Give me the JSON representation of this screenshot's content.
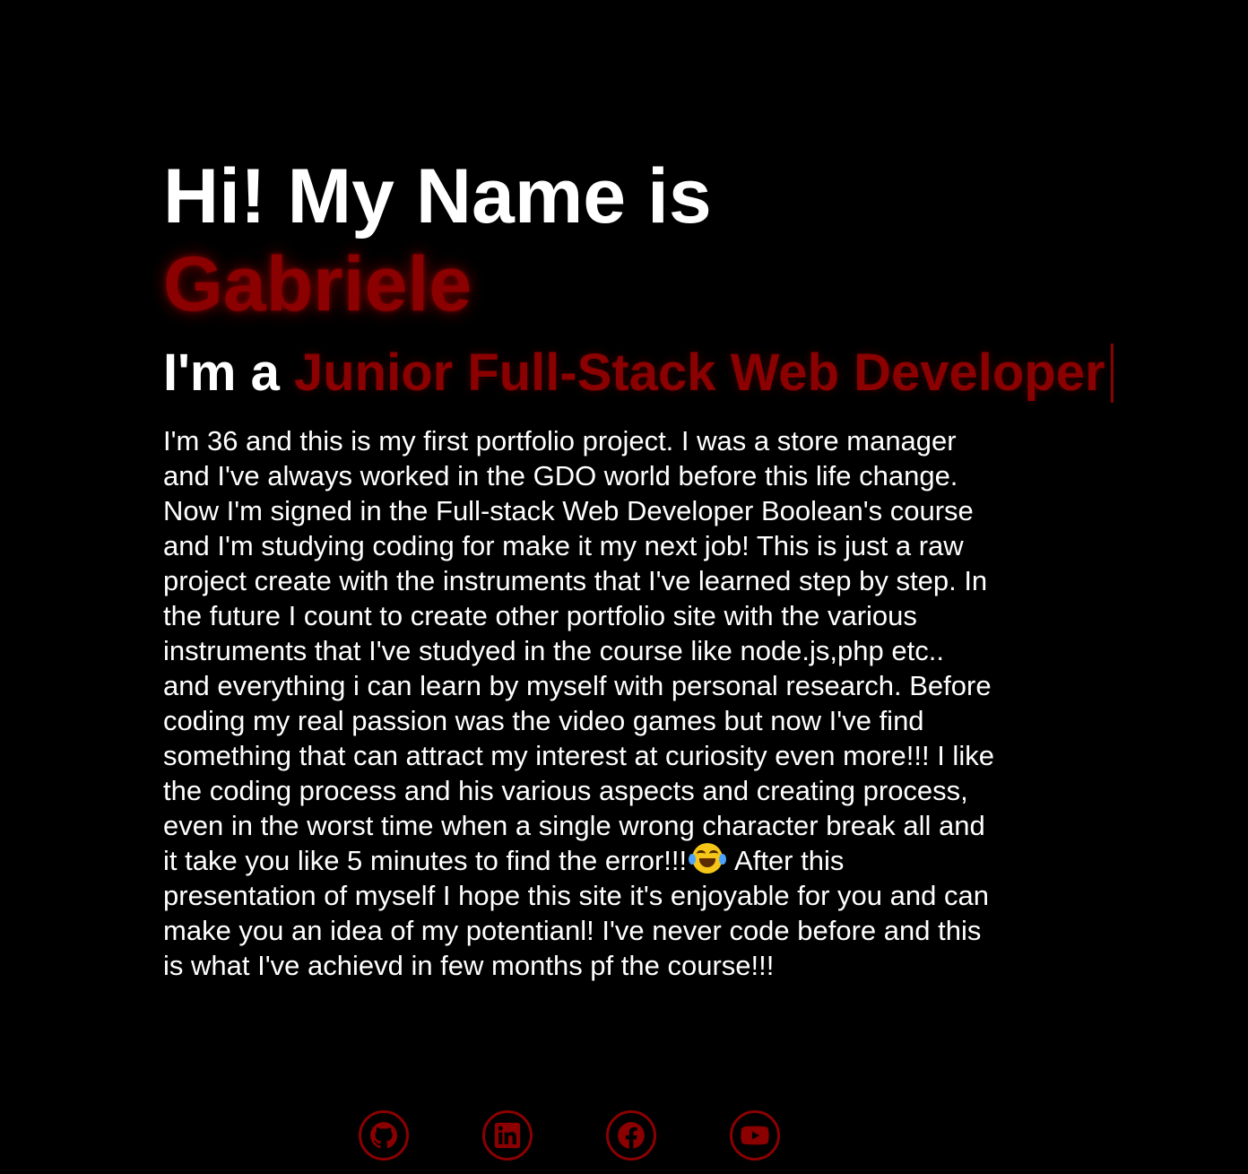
{
  "hero": {
    "greeting": "Hi! My Name is",
    "name": "Gabriele",
    "role_prefix": "I'm a",
    "role": "Junior Full-Stack Web Developer"
  },
  "bio": {
    "text_part1": "I'm 36 and this is my first portfolio project. I was a store manager and I've always worked in the GDO world before this life change. Now I'm signed in the Full-stack Web Developer Boolean's course and I'm studying coding for make it my next job! This is just a raw project create with the instruments that I've learned step by step. In the future I count to create other portfolio site with the various instruments that I've studyed in the course like node.js,php etc.. and everything i can learn by myself with personal research. Before coding my real passion was the video games but now I've find something that can attract my interest at curiosity even more!!! I like the coding process and his various aspects and creating process, even in the worst time when a single wrong character break all and it take you like 5 minutes to find the error!!!",
    "emoji_icon": "laughing-tears-emoji",
    "text_part2": "After this presentation of myself I hope this site it's enjoyable for you and can make you an idea of my potentianl! I've never code before and this is what I've achievd in few months pf the course!!!"
  },
  "socials": [
    {
      "icon": "github-icon"
    },
    {
      "icon": "linkedin-icon"
    },
    {
      "icon": "facebook-icon"
    },
    {
      "icon": "youtube-icon"
    }
  ],
  "colors": {
    "background": "#000000",
    "text": "#ffffff",
    "accent": "#8b0000"
  }
}
